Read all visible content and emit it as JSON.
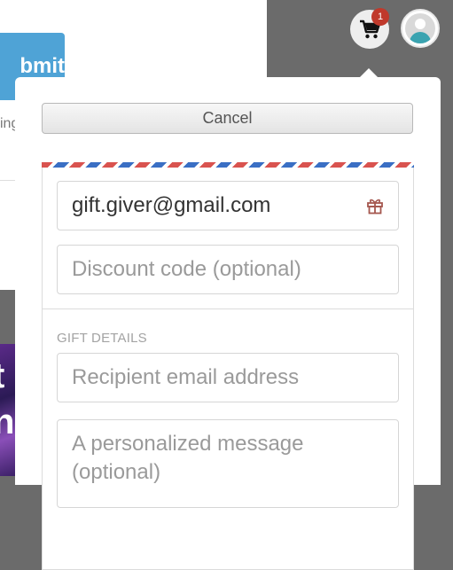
{
  "background": {
    "submit_label": "bmit",
    "partial_text": "ing",
    "image_text": "t\nn"
  },
  "header": {
    "cart_badge_count": "1",
    "cart_icon": "shopping-cart-icon",
    "avatar_icon": "user-avatar-icon"
  },
  "panel": {
    "cancel_label": "Cancel",
    "email_value": "gift.giver@gmail.com",
    "gift_icon": "gift-icon",
    "discount_placeholder": "Discount code (optional)",
    "gift_details_label": "GIFT DETAILS",
    "recipient_placeholder": "Recipient email address",
    "message_placeholder": "A personalized message (optional)"
  },
  "colors": {
    "overlay": "#6b6b6b",
    "badge": "#c0392b",
    "airmail_red": "#d9534f",
    "airmail_blue": "#3a6fc4",
    "submit_blue": "#4fa3d6"
  }
}
